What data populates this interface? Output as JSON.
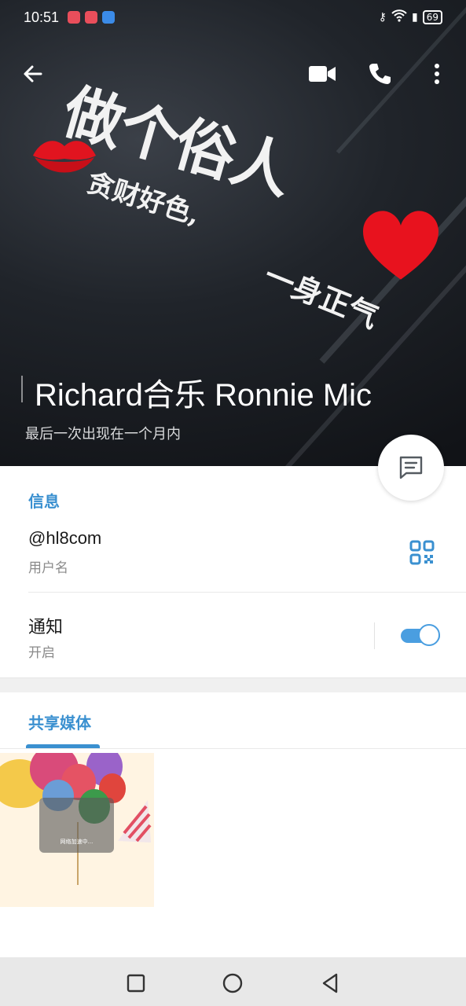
{
  "status_bar": {
    "time": "10:51",
    "battery": "69"
  },
  "profile": {
    "name": "Richard合乐 Ronnie   Mic",
    "last_seen": "最后一次出现在一个月内",
    "cover_calligraphy": [
      "做个俗人",
      "贪财好色,",
      "一身正气"
    ]
  },
  "info": {
    "section_title": "信息",
    "username": "@hl8com",
    "username_label": "用户名",
    "notifications_title": "通知",
    "notifications_state": "开启"
  },
  "media": {
    "tab_label": "共享媒体",
    "thumbnail_text": "网络加速中..."
  },
  "icons": {
    "back": "arrow-left-icon",
    "video": "video-call-icon",
    "call": "phone-icon",
    "more": "more-vertical-icon",
    "message": "message-icon",
    "qr": "qr-code-icon"
  },
  "colors": {
    "accent": "#3a90d0",
    "toggle": "#4a9ee0"
  }
}
